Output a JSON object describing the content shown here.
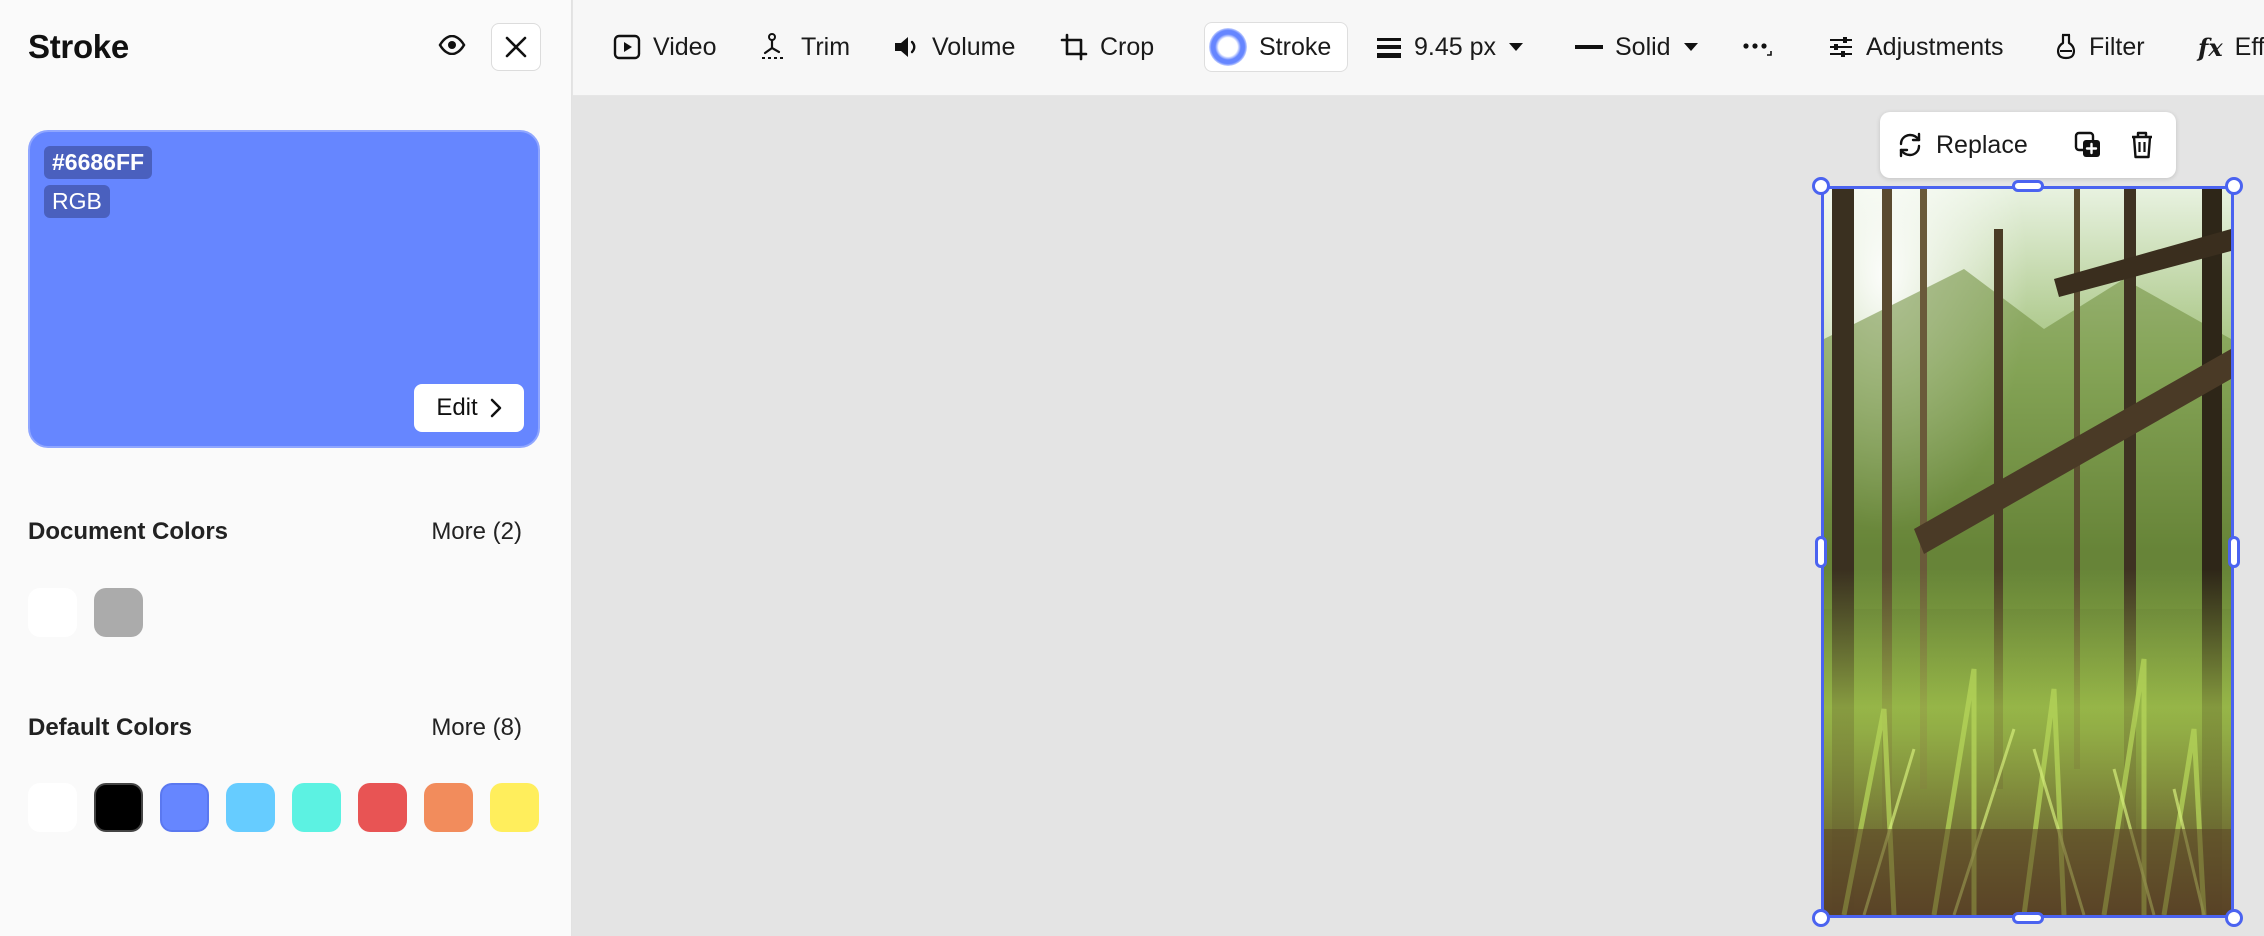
{
  "panel": {
    "title": "Stroke",
    "current_color": {
      "hex": "#6686FF",
      "mode": "RGB",
      "edit_label": "Edit"
    },
    "document_colors": {
      "title": "Document Colors",
      "more_label": "More (2)",
      "swatches": [
        "#ffffff",
        "#ababab"
      ]
    },
    "default_colors": {
      "title": "Default Colors",
      "more_label": "More (8)",
      "swatches": [
        "#ffffff",
        "#000000",
        "#6686ff",
        "#66ccff",
        "#5cf2e2",
        "#e85454",
        "#f28c5c",
        "#ffee5c"
      ]
    }
  },
  "toolbar": {
    "video_label": "Video",
    "trim_label": "Trim",
    "volume_label": "Volume",
    "crop_label": "Crop",
    "stroke_label": "Stroke",
    "stroke_width": "9.45 px",
    "stroke_style": "Solid",
    "adjustments_label": "Adjustments",
    "filter_label": "Filter",
    "effects_label": "Eff"
  },
  "selection_toolbar": {
    "replace_label": "Replace"
  },
  "colors": {
    "accent": "#6686FF",
    "selection": "#4b63f0",
    "canvas": "#e4e4e4"
  }
}
